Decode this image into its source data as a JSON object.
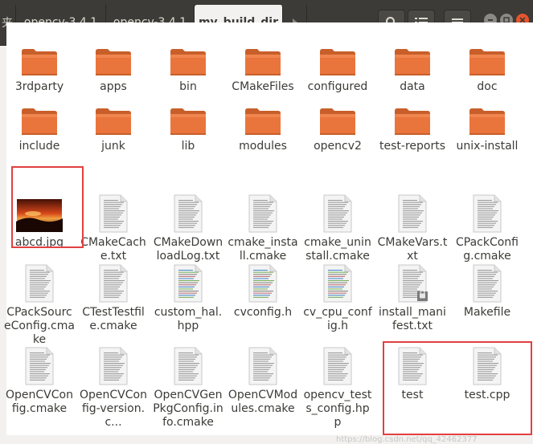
{
  "breadcrumbs": [
    {
      "label": "夹"
    },
    {
      "label": "opencv-3.4.1"
    },
    {
      "label": "opencv-3.4.1"
    },
    {
      "label": "my_build_dir"
    }
  ],
  "toolbar": {
    "search_icon": "search-icon",
    "view_icon": "list-view-icon",
    "menu_icon": "hamburger-menu-icon"
  },
  "colors": {
    "folder_top": "#f0854f",
    "folder_body": "#e9753c",
    "highlight": "#e34040",
    "toolbar_bg": "#3c3b37",
    "close_button": "#e8542c"
  },
  "files": [
    {
      "name": "3rdparty",
      "type": "folder"
    },
    {
      "name": "apps",
      "type": "folder"
    },
    {
      "name": "bin",
      "type": "folder"
    },
    {
      "name": "CMakeFiles",
      "type": "folder"
    },
    {
      "name": "configured",
      "type": "folder"
    },
    {
      "name": "data",
      "type": "folder"
    },
    {
      "name": "doc",
      "type": "folder"
    },
    {
      "name": "include",
      "type": "folder"
    },
    {
      "name": "junk",
      "type": "folder"
    },
    {
      "name": "lib",
      "type": "folder"
    },
    {
      "name": "modules",
      "type": "folder"
    },
    {
      "name": "opencv2",
      "type": "folder"
    },
    {
      "name": "test-reports",
      "type": "folder"
    },
    {
      "name": "unix-install",
      "type": "folder"
    },
    {
      "name": "abcd.jpg",
      "type": "image"
    },
    {
      "name": "CMakeCache.txt",
      "type": "text"
    },
    {
      "name": "CMakeDownloadLog.txt",
      "type": "text"
    },
    {
      "name": "cmake_install.cmake",
      "type": "text"
    },
    {
      "name": "cmake_uninstall.cmake",
      "type": "text"
    },
    {
      "name": "CMakeVars.txt",
      "type": "text"
    },
    {
      "name": "CPackConfig.cmake",
      "type": "text"
    },
    {
      "name": "CPackSourceConfig.cmake",
      "type": "text"
    },
    {
      "name": "CTestTestfile.cmake",
      "type": "text"
    },
    {
      "name": "custom_hal.hpp",
      "type": "code"
    },
    {
      "name": "cvconfig.h",
      "type": "code"
    },
    {
      "name": "cv_cpu_config.h",
      "type": "code"
    },
    {
      "name": "install_manifest.txt",
      "type": "locked"
    },
    {
      "name": "Makefile",
      "type": "text"
    },
    {
      "name": "OpenCVConfig.cmake",
      "type": "text"
    },
    {
      "name": "OpenCVConfig-version.c...",
      "type": "text"
    },
    {
      "name": "OpenCVGenPkgConfig.info.cmake",
      "type": "text"
    },
    {
      "name": "OpenCVModules.cmake",
      "type": "text"
    },
    {
      "name": "opencv_tests_config.hpp",
      "type": "text"
    },
    {
      "name": "test",
      "type": "text"
    },
    {
      "name": "test.cpp",
      "type": "text"
    }
  ],
  "watermark": "https://blog.csdn.net/qq_42462377"
}
